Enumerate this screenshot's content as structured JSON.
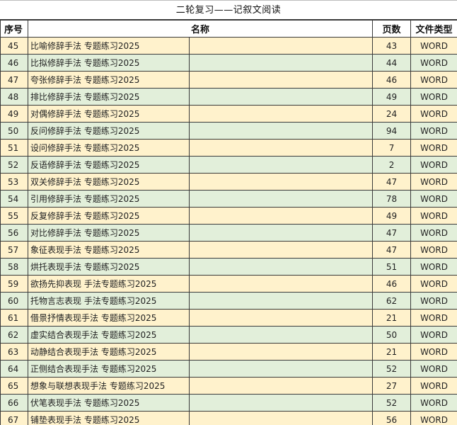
{
  "title": "二轮复习——记叙文阅读",
  "headers": {
    "seq": "序号",
    "name": "名称",
    "pages": "页数",
    "type": "文件类型"
  },
  "rows": [
    {
      "seq": "45",
      "name": "比喻修辞手法  专题练习2025",
      "pages": "43",
      "type": "WORD"
    },
    {
      "seq": "46",
      "name": "比拟修辞手法  专题练习2025",
      "pages": "44",
      "type": "WORD"
    },
    {
      "seq": "47",
      "name": "夸张修辞手法  专题练习2025",
      "pages": "46",
      "type": "WORD"
    },
    {
      "seq": "48",
      "name": "排比修辞手法  专题练习2025",
      "pages": "49",
      "type": "WORD"
    },
    {
      "seq": "49",
      "name": "对偶修辞手法  专题练习2025",
      "pages": "24",
      "type": "WORD"
    },
    {
      "seq": "50",
      "name": "反问修辞手法  专题练习2025",
      "pages": "94",
      "type": "WORD"
    },
    {
      "seq": "51",
      "name": "设问修辞手法  专题练习2025",
      "pages": "7",
      "type": "WORD"
    },
    {
      "seq": "52",
      "name": "反语修辞手法  专题练习2025",
      "pages": "2",
      "type": "WORD"
    },
    {
      "seq": "53",
      "name": "双关修辞手法  专题练习2025",
      "pages": "47",
      "type": "WORD"
    },
    {
      "seq": "54",
      "name": "引用修辞手法  专题练习2025",
      "pages": "78",
      "type": "WORD"
    },
    {
      "seq": "55",
      "name": "反复修辞手法  专题练习2025",
      "pages": "49",
      "type": "WORD"
    },
    {
      "seq": "56",
      "name": "对比修辞手法  专题练习2025",
      "pages": "47",
      "type": "WORD"
    },
    {
      "seq": "57",
      "name": "象征表现手法  专题练习2025",
      "pages": "47",
      "type": "WORD"
    },
    {
      "seq": "58",
      "name": "烘托表现手法  专题练习2025",
      "pages": "51",
      "type": "WORD"
    },
    {
      "seq": "59",
      "name": "欲扬先抑表现  手法专题练习2025",
      "pages": "46",
      "type": "WORD"
    },
    {
      "seq": "60",
      "name": "托物言志表现  手法专题练习2025",
      "pages": "62",
      "type": "WORD"
    },
    {
      "seq": "61",
      "name": "借景抒情表现手法  专题练习2025",
      "pages": "21",
      "type": "WORD"
    },
    {
      "seq": "62",
      "name": "虚实结合表现手法  专题练习2025",
      "pages": "50",
      "type": "WORD"
    },
    {
      "seq": "63",
      "name": "动静结合表现手法  专题练习2025",
      "pages": "21",
      "type": "WORD"
    },
    {
      "seq": "64",
      "name": "正侧结合表现手法  专题练习2025",
      "pages": "52",
      "type": "WORD"
    },
    {
      "seq": "65",
      "name": "想象与联想表现手法  专题练习2025",
      "pages": "27",
      "type": "WORD"
    },
    {
      "seq": "66",
      "name": "伏笔表现手法  专题练习2025",
      "pages": "52",
      "type": "WORD"
    },
    {
      "seq": "67",
      "name": "铺垫表现手法  专题练习2025",
      "pages": "56",
      "type": "WORD"
    }
  ]
}
